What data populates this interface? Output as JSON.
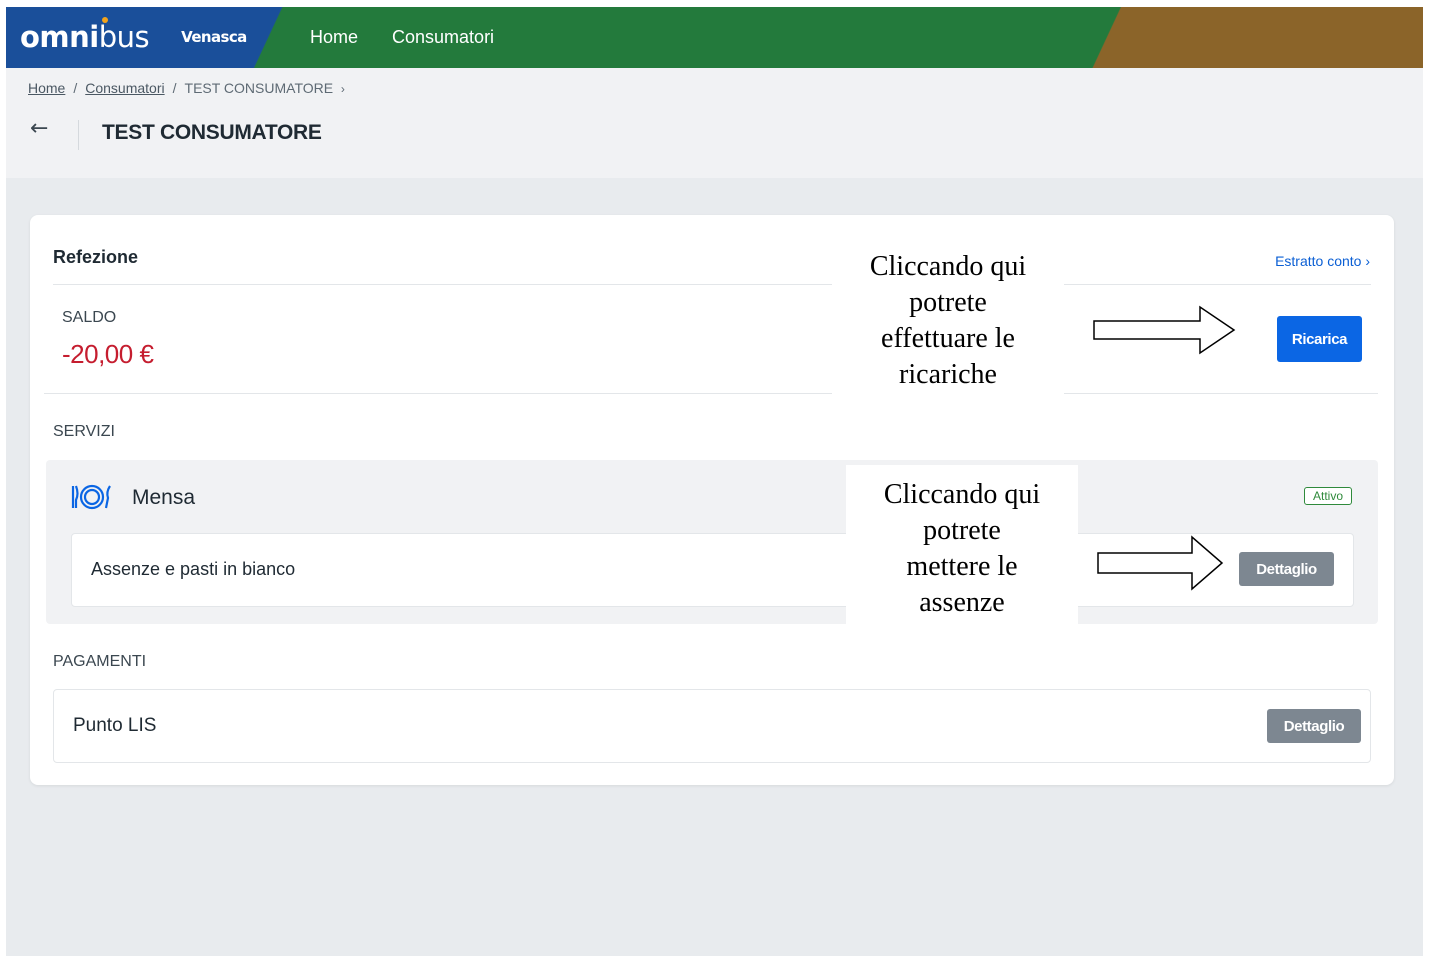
{
  "header": {
    "logo_bold": "omni",
    "logo_light": "bus",
    "org": "Venasca",
    "nav": [
      "Home",
      "Consumatori"
    ]
  },
  "breadcrumb": {
    "items": [
      "Home",
      "Consumatori",
      "TEST CONSUMATORE"
    ],
    "sep": "/",
    "end": "›"
  },
  "page": {
    "back": "←",
    "title": "TEST CONSUMATORE"
  },
  "refezione": {
    "title": "Refezione",
    "estratto_label": "Estratto conto ›",
    "saldo_label": "SALDO",
    "saldo_value": "-20,00 €",
    "ricarica_label": "Ricarica"
  },
  "servizi": {
    "title": "SERVIZI",
    "mensa_label": "Mensa",
    "mensa_icon": "plate-cutlery-icon",
    "status": "Attivo",
    "row_label": "Assenze e pasti in bianco",
    "row_button": "Dettaglio"
  },
  "pagamenti": {
    "title": "PAGAMENTI",
    "row_label": "Punto LIS",
    "row_button": "Dettaglio"
  },
  "annotations": {
    "note1": [
      "Cliccando qui",
      "potrete",
      "effettuare le",
      "ricariche"
    ],
    "note2": [
      "Cliccando qui",
      "potrete",
      "mettere le",
      "assenze"
    ]
  },
  "colors": {
    "primary": "#0b66e4",
    "danger": "#c51d2f",
    "success": "#2f8a3b",
    "header_blue": "#1a4f9a",
    "header_green": "#237a3c",
    "header_brown": "#8b6429"
  }
}
